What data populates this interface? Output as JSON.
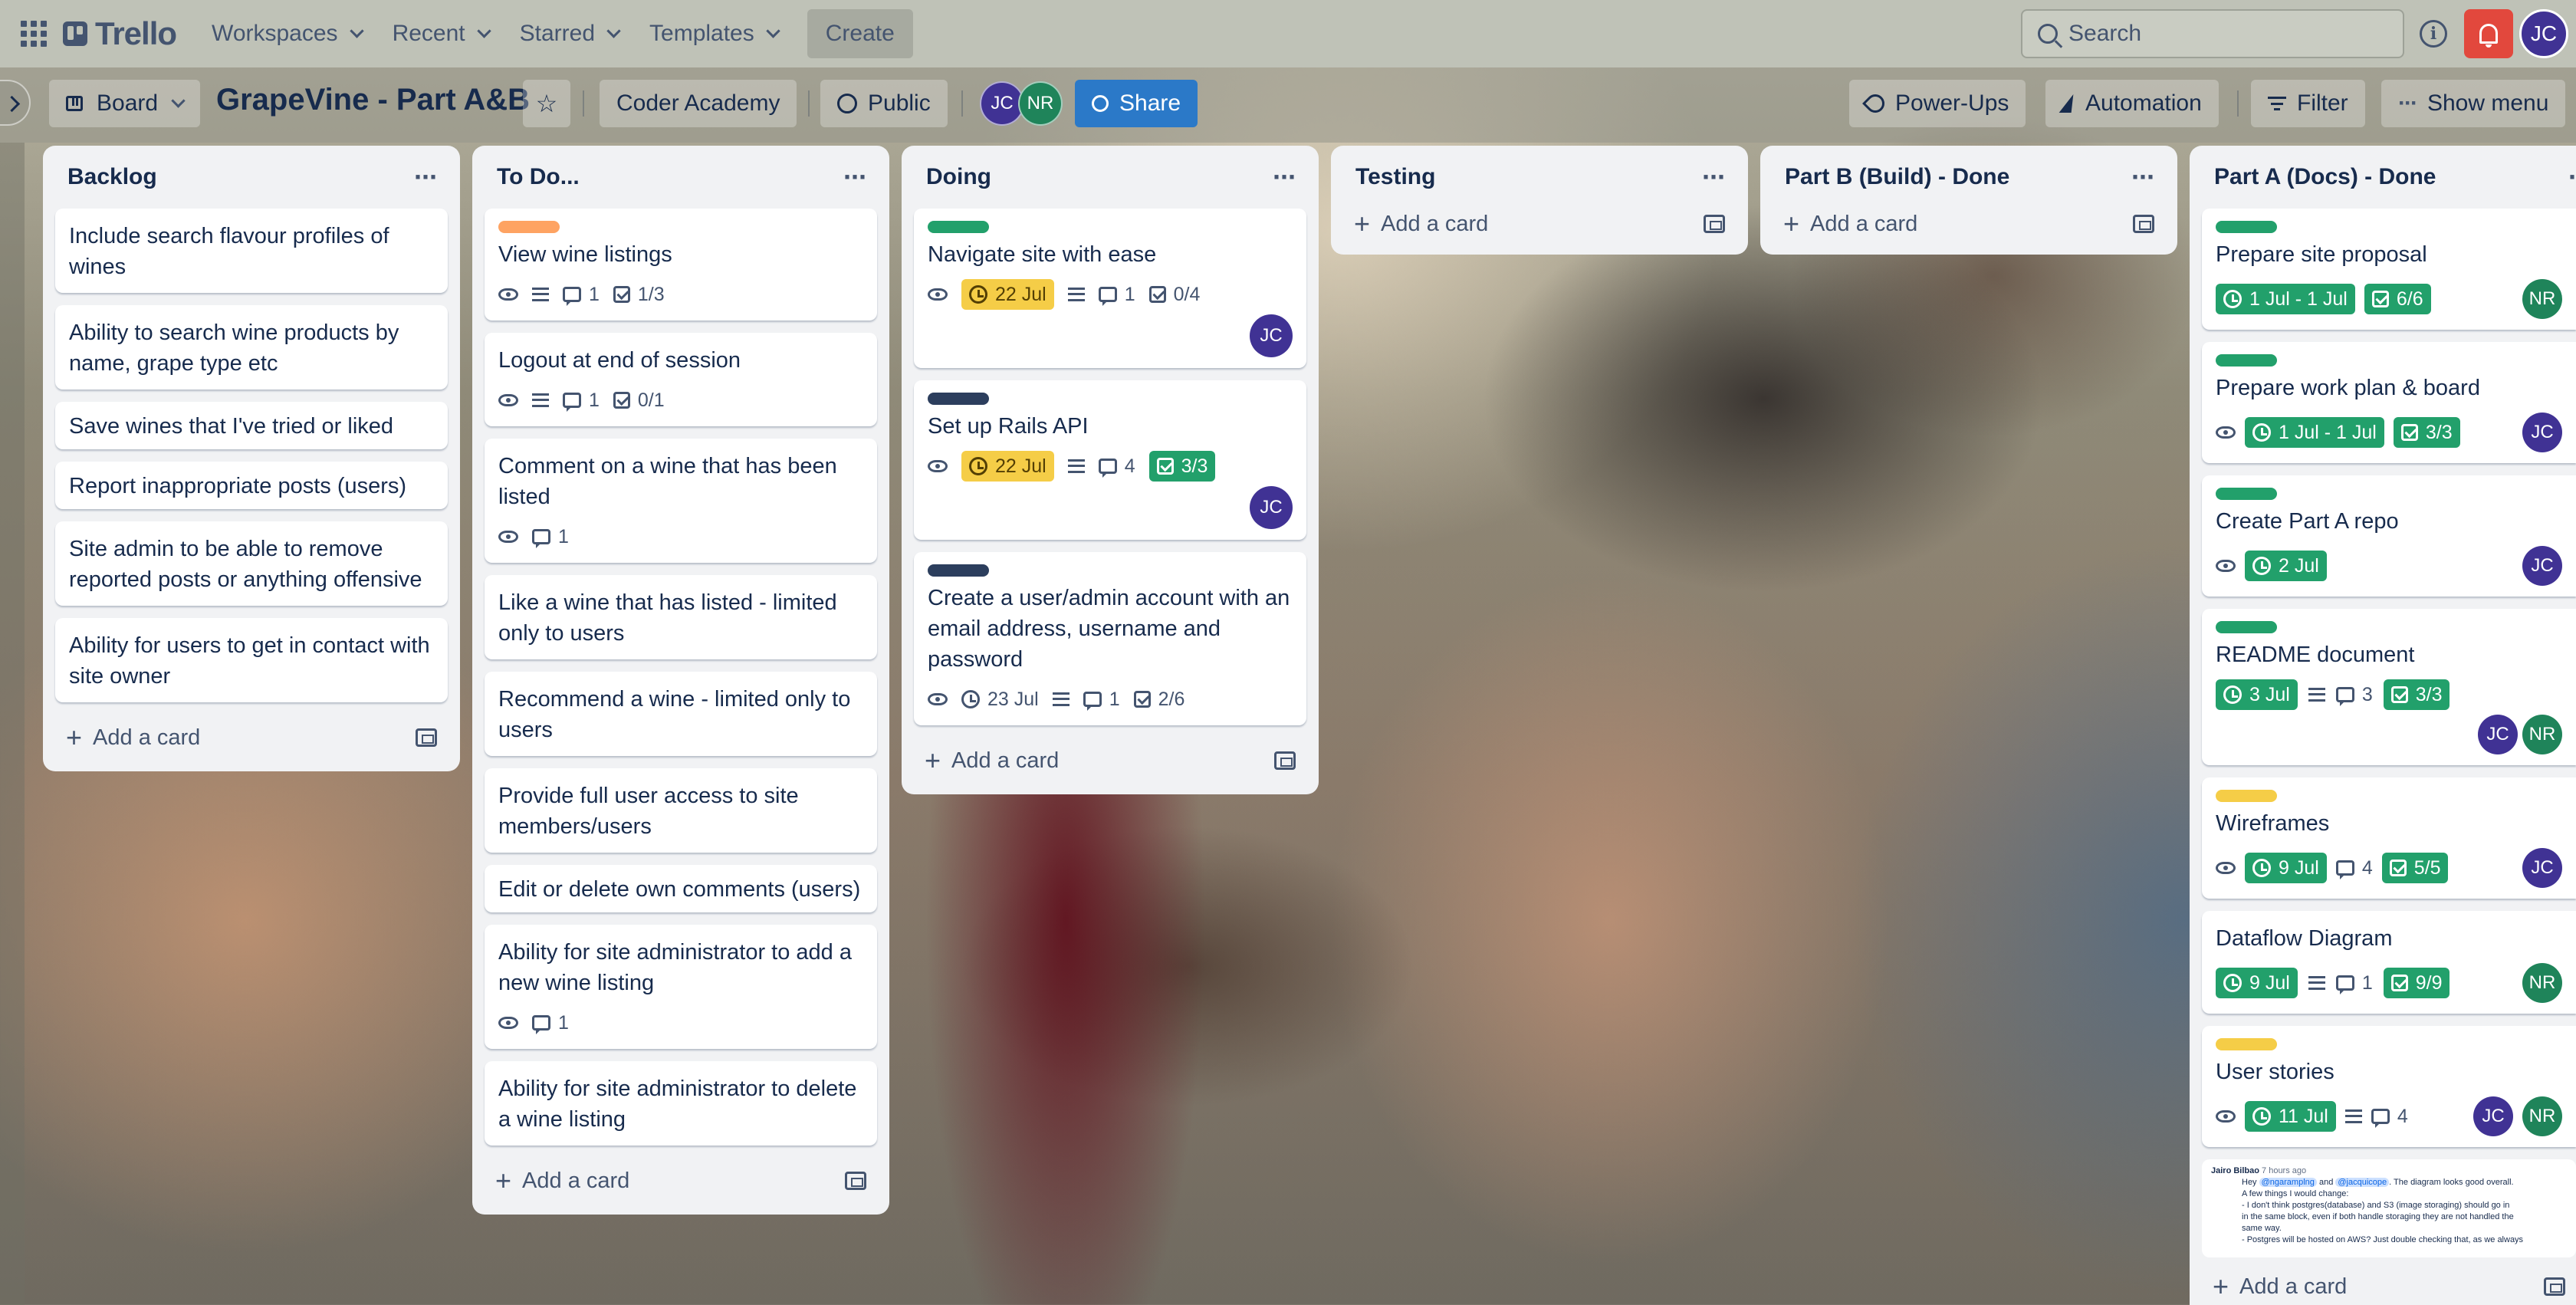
{
  "topbar": {
    "logo": "Trello",
    "nav": [
      "Workspaces",
      "Recent",
      "Starred",
      "Templates"
    ],
    "create": "Create",
    "search_placeholder": "Search",
    "user_initials": "JC"
  },
  "board": {
    "view": "Board",
    "title": "GrapeVine - Part A&B",
    "workspace": "Coder Academy",
    "visibility": "Public",
    "members": [
      "JC",
      "NR"
    ],
    "share": "Share",
    "powerups": "Power-Ups",
    "automation": "Automation",
    "filter": "Filter",
    "show_menu": "Show menu"
  },
  "add_card": "Add a card",
  "colors": {
    "green": "#22a06b",
    "yellow": "#f5cd47",
    "orange": "#fea362",
    "navy": "#2c3e5d",
    "avatar_jc": "#403294",
    "avatar_nr": "#1f845a"
  },
  "lists": [
    {
      "title": "Backlog",
      "cards": [
        {
          "title": "Include search flavour profiles of wines"
        },
        {
          "title": "Ability to search wine products by name, grape type etc"
        },
        {
          "title": "Save wines that I've tried or liked"
        },
        {
          "title": "Report inappropriate posts (users)"
        },
        {
          "title": "Site admin to be able to remove reported posts or anything offensive"
        },
        {
          "title": "Ability for users to get in contact with site owner"
        }
      ]
    },
    {
      "title": "To Do...",
      "cards": [
        {
          "title": "View wine listings",
          "comments": "1",
          "checklist": "1/3"
        },
        {
          "title": "Logout at end of session",
          "comments": "1",
          "checklist": "0/1"
        },
        {
          "title": "Comment on a wine that has been listed",
          "comments": "1"
        },
        {
          "title": "Like a wine that has listed - limited only to users"
        },
        {
          "title": "Recommend a wine - limited only to users"
        },
        {
          "title": "Provide full user access to site members/users"
        },
        {
          "title": "Edit or delete own comments (users)"
        },
        {
          "title": "Ability for site administrator to add a new wine listing",
          "comments": "1"
        },
        {
          "title": "Ability for site administrator to delete a wine listing"
        }
      ]
    },
    {
      "title": "Doing",
      "cards": [
        {
          "title": "Navigate site with ease",
          "due": "22 Jul",
          "comments": "1",
          "checklist": "0/4"
        },
        {
          "title": "Set up Rails API",
          "due": "22 Jul",
          "comments": "4",
          "checklist": "3/3"
        },
        {
          "title": "Create a user/admin account with an email address, username and password",
          "due": "23 Jul",
          "comments": "1",
          "checklist": "2/6"
        }
      ]
    },
    {
      "title": "Testing",
      "cards": []
    },
    {
      "title": "Part B (Build) - Done",
      "cards": []
    },
    {
      "title": "Part A (Docs) - Done",
      "cards": [
        {
          "title": "Prepare site proposal",
          "due": "1 Jul - 1 Jul",
          "checklist": "6/6"
        },
        {
          "title": "Prepare work plan & board",
          "due": "1 Jul - 1 Jul",
          "checklist": "3/3"
        },
        {
          "title": "Create Part A repo",
          "due": "2 Jul"
        },
        {
          "title": "README document",
          "due": "3 Jul",
          "comments": "3",
          "checklist": "3/3"
        },
        {
          "title": "Wireframes",
          "due": "9 Jul",
          "comments": "4",
          "checklist": "5/5"
        },
        {
          "title": "Dataflow Diagram",
          "due": "9 Jul",
          "comments": "1",
          "checklist": "9/9"
        },
        {
          "title": "User stories",
          "due": "11 Jul",
          "comments": "4"
        }
      ]
    }
  ],
  "comment_preview": {
    "author": "Jairo Bilbao",
    "time": "7 hours ago",
    "line1_a": "Hey",
    "mention1": "@ngaramplng",
    "line1_b": "and",
    "mention2": "@jacquicope",
    "line1_c": ". The diagram looks good overall.",
    "line2": "A few things I would change:",
    "line3": "- I don't think postgres(database) and S3 (image storaging) should go in",
    "line4": "in the same block, even if both handle storaging they are not handled the",
    "line5": "same way.",
    "line6": "- Postgres will be hosted on AWS? Just double checking that, as we always"
  }
}
